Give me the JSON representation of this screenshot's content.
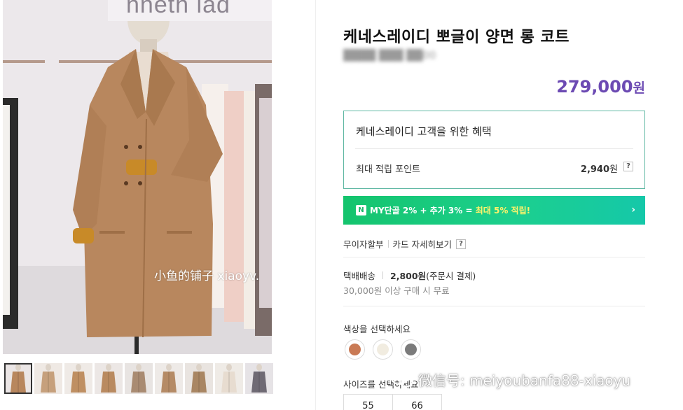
{
  "gallery": {
    "watermark": "小鱼的铺子 xiaoyv.",
    "store_sign": "nneth lad",
    "thumbnail_count": 9
  },
  "product": {
    "title": "케네스레이디 뽀글이 양면 롱 코트",
    "sku": "████ ███ ██00",
    "price": "279,000",
    "price_unit": "원"
  },
  "benefit": {
    "title": "케네스레이디 고객을 위한 혜택",
    "point_label": "최대 적립 포인트",
    "point_value": "2,940",
    "point_unit": "원",
    "help": "?"
  },
  "promo": {
    "badge": "N",
    "text_main": "MY단골 2% + 추가 3% = ",
    "text_highlight": "최대 5% 적립!",
    "chevron": "›",
    "colors": {
      "start": "#14c46d",
      "end": "#15c8a9",
      "highlight": "#fff36b"
    }
  },
  "installment": {
    "label": "무이자할부",
    "link": "카드 자세히보기",
    "help": "?"
  },
  "shipping": {
    "label": "택배배송",
    "fee": "2,800원",
    "fee_note": "(주문시 결제)",
    "free_condition": "30,000원 이상 구매 시 무료"
  },
  "options": {
    "color_label": "색상을 선택하세요",
    "colors": [
      "#c97a55",
      "#f1ece0",
      "#7b7b7b"
    ],
    "size_label": "사이즈를 선택하세요",
    "sizes": [
      "55",
      "66"
    ]
  },
  "overlay_watermark": {
    "text": "微信号: meiyoubanfa88-xiaoyu",
    "icon": "wechat-icon"
  },
  "theme": {
    "price_color": "#6c4ab3",
    "box_border": "#5fb8a3"
  }
}
